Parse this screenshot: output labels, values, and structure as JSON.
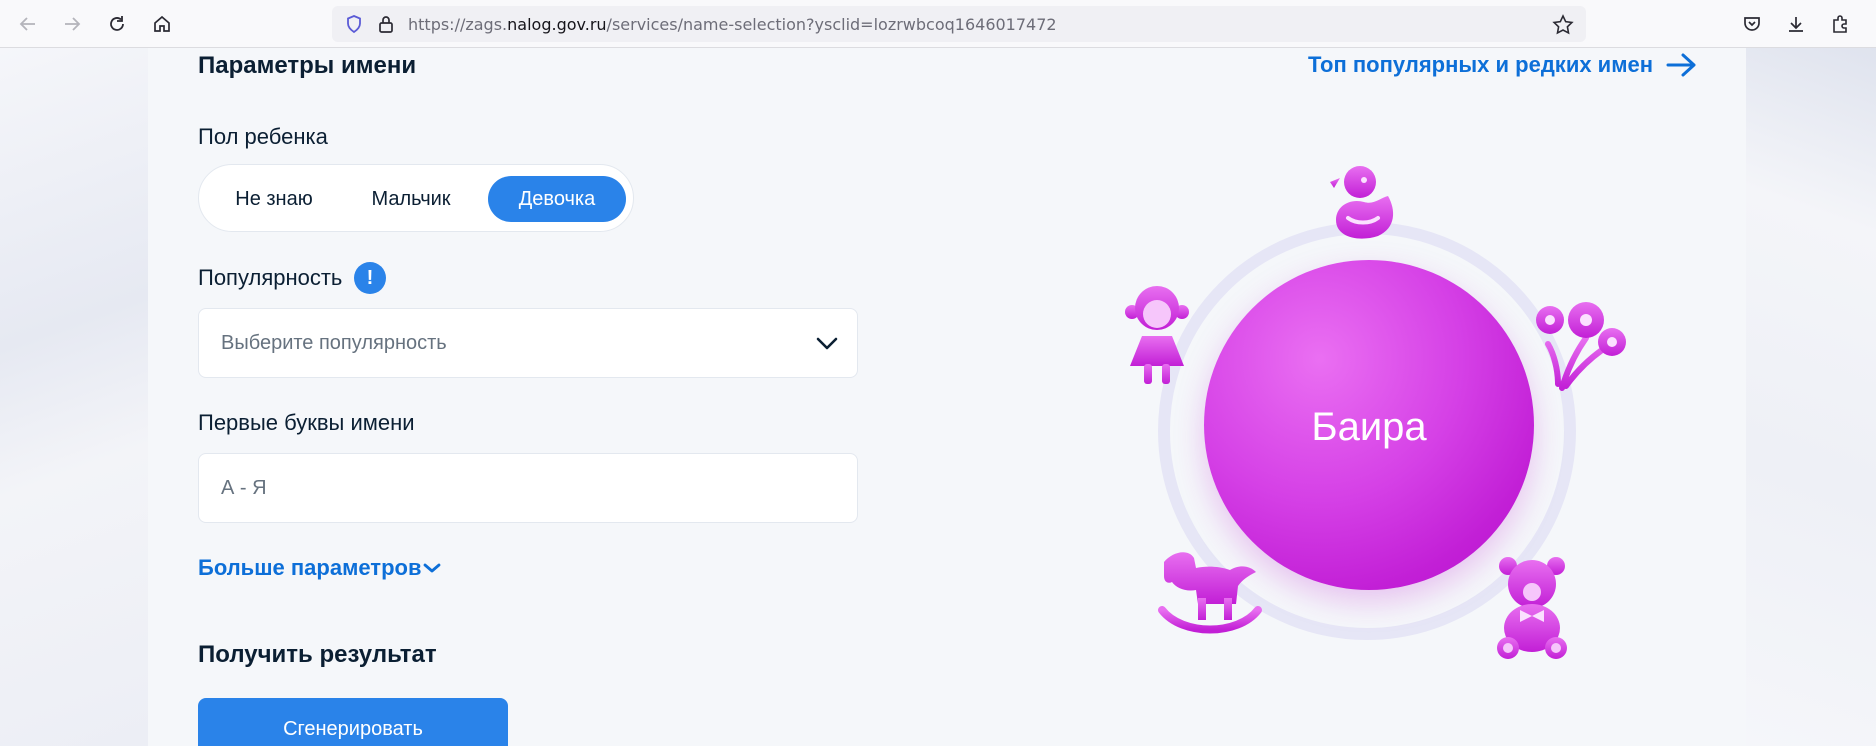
{
  "browser": {
    "url_prefix": "https://zags.",
    "url_host": "nalog.gov.ru",
    "url_path": "/services/name-selection?ysclid=lozrwbcoq1646017472"
  },
  "form": {
    "title": "Параметры имени",
    "top_link": "Топ популярных и редких имен",
    "gender_label": "Пол ребенка",
    "gender_options": [
      "Не знаю",
      "Мальчик",
      "Девочка"
    ],
    "gender_selected": "Девочка",
    "popularity_label": "Популярность",
    "popularity_info": "!",
    "popularity_placeholder": "Выберите популярность",
    "letters_label": "Первые буквы имени",
    "letters_placeholder": "А - Я",
    "more_params": "Больше параметров",
    "result_title": "Получить результат",
    "generate_button": "Сгенерировать"
  },
  "result": {
    "name": "Баира"
  },
  "colors": {
    "accent": "#2a83e9",
    "link": "#0d6fd8",
    "orb": "#d540e6",
    "text": "#0b1f33"
  },
  "icons": [
    "back-arrow-icon",
    "forward-arrow-icon",
    "reload-icon",
    "home-icon",
    "shield-icon",
    "lock-icon",
    "star-icon",
    "pocket-icon",
    "download-icon",
    "extensions-icon",
    "arrow-right-icon",
    "chevron-down-icon",
    "duck-icon",
    "doll-icon",
    "flowers-icon",
    "rocking-horse-icon",
    "teddy-bear-icon"
  ]
}
